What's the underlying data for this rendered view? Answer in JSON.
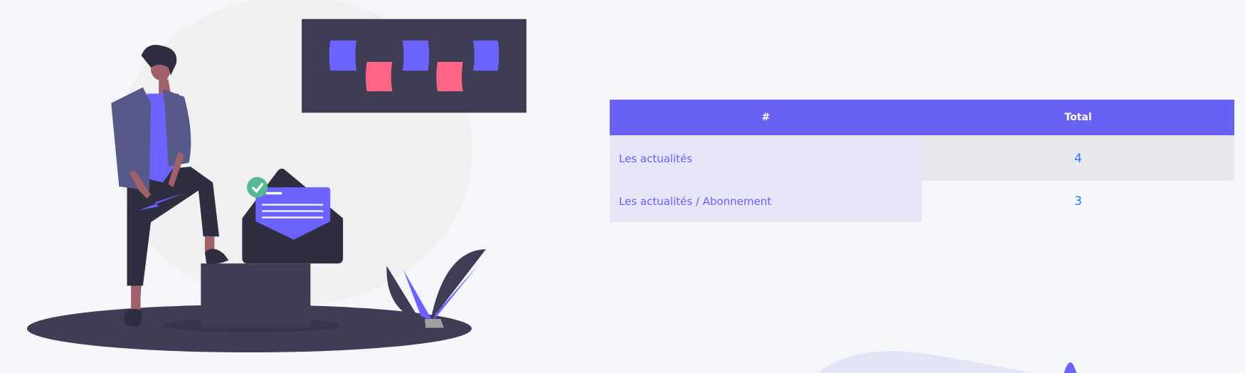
{
  "table": {
    "headers": [
      "#",
      "Total"
    ],
    "rows": [
      {
        "label": "Les actualités",
        "total": "4"
      },
      {
        "label": "Les actualités / Abonnement",
        "total": "3"
      }
    ]
  },
  "colors": {
    "accent": "#6861f2",
    "value": "#2a7bf0",
    "pink": "#ff6584",
    "dark": "#3f3d56"
  }
}
